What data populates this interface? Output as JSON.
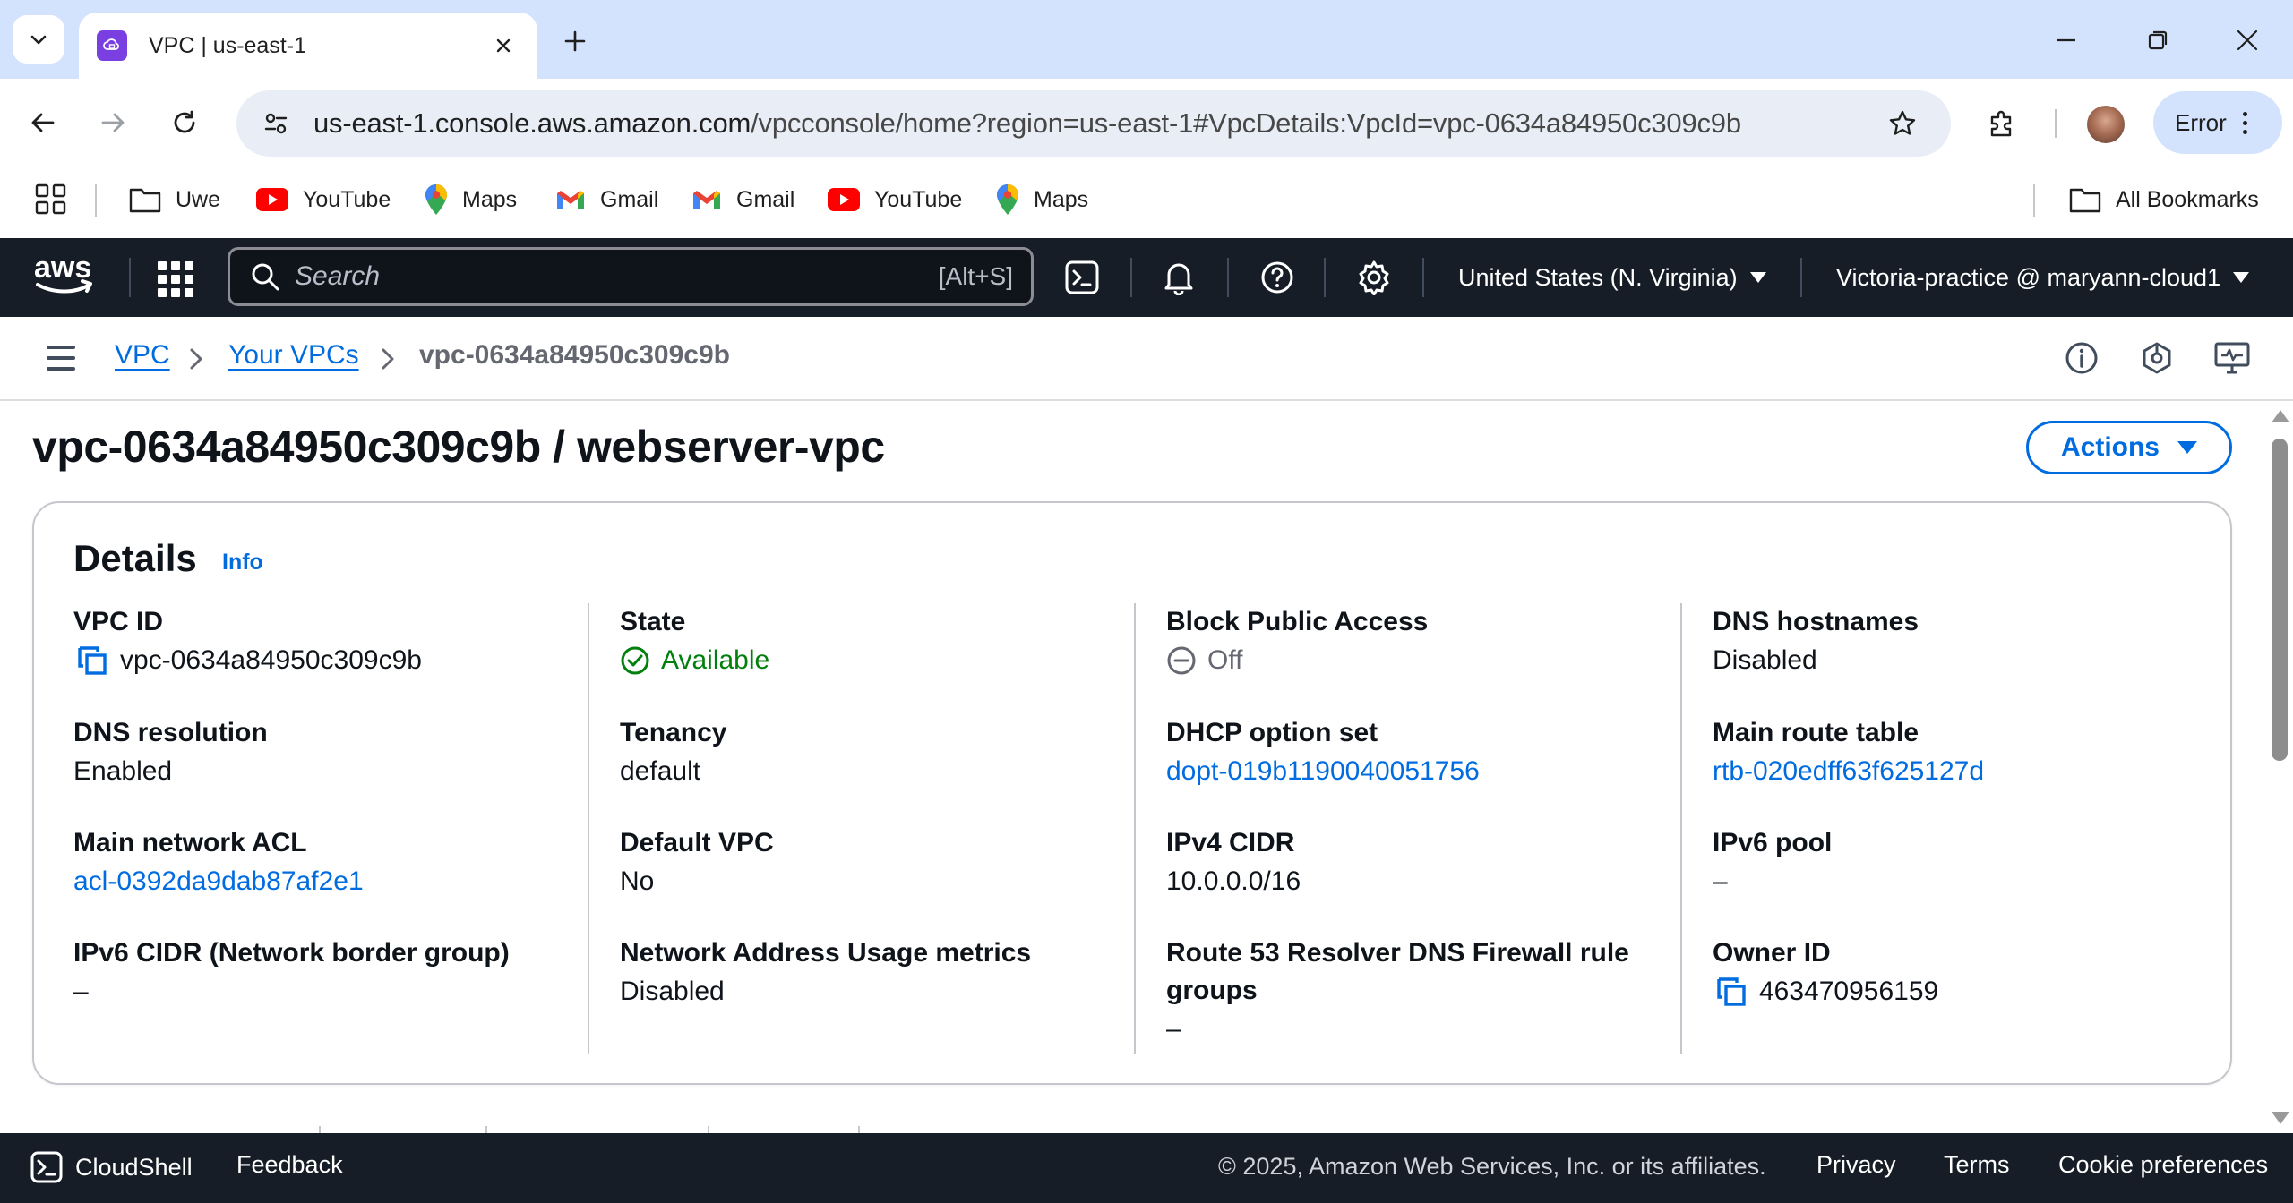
{
  "browser": {
    "tab_title": "VPC | us-east-1",
    "url_host": "us-east-1.console.aws.amazon.com",
    "url_rest": "/vpcconsole/home?region=us-east-1#VpcDetails:VpcId=vpc-0634a84950c309c9b",
    "profile_chip": "Error",
    "bookmarks": [
      {
        "label": "Uwe",
        "icon": "folder-icon"
      },
      {
        "label": "YouTube",
        "icon": "youtube-icon"
      },
      {
        "label": "Maps",
        "icon": "maps-icon"
      },
      {
        "label": "Gmail",
        "icon": "gmail-icon"
      },
      {
        "label": "Gmail",
        "icon": "gmail-icon"
      },
      {
        "label": "YouTube",
        "icon": "youtube-icon"
      },
      {
        "label": "Maps",
        "icon": "maps-icon"
      }
    ],
    "all_bookmarks": "All Bookmarks"
  },
  "aws_nav": {
    "search_placeholder": "Search",
    "search_shortcut": "[Alt+S]",
    "region": "United States (N. Virginia)",
    "account": "Victoria-practice @ maryann-cloud1"
  },
  "breadcrumb": {
    "items": [
      "VPC",
      "Your VPCs"
    ],
    "current": "vpc-0634a84950c309c9b"
  },
  "page": {
    "title": "vpc-0634a84950c309c9b / webserver-vpc",
    "actions_label": "Actions"
  },
  "details": {
    "heading": "Details",
    "info_link": "Info",
    "fields": {
      "vpc_id": {
        "label": "VPC ID",
        "value": "vpc-0634a84950c309c9b"
      },
      "state": {
        "label": "State",
        "value": "Available"
      },
      "block_public_access": {
        "label": "Block Public Access",
        "value": "Off"
      },
      "dns_hostnames": {
        "label": "DNS hostnames",
        "value": "Disabled"
      },
      "dns_resolution": {
        "label": "DNS resolution",
        "value": "Enabled"
      },
      "tenancy": {
        "label": "Tenancy",
        "value": "default"
      },
      "dhcp_option_set": {
        "label": "DHCP option set",
        "value": "dopt-019b1190040051756"
      },
      "main_route_table": {
        "label": "Main route table",
        "value": "rtb-020edff63f625127d"
      },
      "main_network_acl": {
        "label": "Main network ACL",
        "value": "acl-0392da9dab87af2e1"
      },
      "default_vpc": {
        "label": "Default VPC",
        "value": "No"
      },
      "ipv4_cidr": {
        "label": "IPv4 CIDR",
        "value": "10.0.0.0/16"
      },
      "ipv6_pool": {
        "label": "IPv6 pool",
        "value": "–"
      },
      "ipv6_cidr": {
        "label": "IPv6 CIDR (Network border group)",
        "value": "–"
      },
      "nau_metrics": {
        "label": "Network Address Usage metrics",
        "value": "Disabled"
      },
      "route53_firewall": {
        "label": "Route 53 Resolver DNS Firewall rule groups",
        "value": "–"
      },
      "owner_id": {
        "label": "Owner ID",
        "value": "463470956159"
      }
    }
  },
  "footer": {
    "cloudshell": "CloudShell",
    "feedback": "Feedback",
    "copyright": "© 2025, Amazon Web Services, Inc. or its affiliates.",
    "privacy": "Privacy",
    "terms": "Terms",
    "cookie_preferences": "Cookie preferences"
  },
  "colors": {
    "aws_nav_bg": "#161d26",
    "link_blue": "#006ce0",
    "success_green": "#037f0c",
    "chrome_tabstrip": "#d3e3fd"
  }
}
